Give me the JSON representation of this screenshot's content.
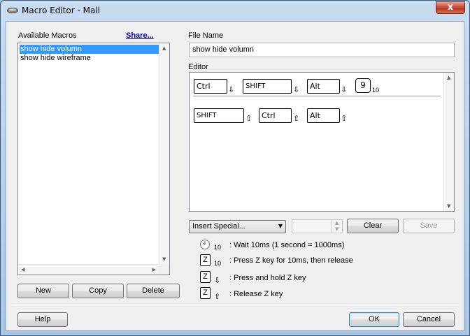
{
  "window": {
    "title": "Macro Editor - Mail",
    "close_label": "x"
  },
  "left": {
    "available_label": "Available Macros",
    "share_label": "Share...",
    "macros": [
      "show hide volumn",
      "show hide wireframe"
    ],
    "new_label": "New",
    "copy_label": "Copy",
    "delete_label": "Delete"
  },
  "right": {
    "file_name_label": "File Name",
    "file_name_value": "show hide volumn",
    "editor_label": "Editor",
    "row1": [
      {
        "key": "Ctrl",
        "icon": "⇩"
      },
      {
        "key": "SHIFT",
        "icon": "⇩"
      },
      {
        "key": "Alt",
        "icon": "⇩"
      },
      {
        "key": "9",
        "sub": "10"
      }
    ],
    "row2": [
      {
        "key": "SHIFT",
        "icon": "⇧"
      },
      {
        "key": "Ctrl",
        "icon": "⇧"
      },
      {
        "key": "Alt",
        "icon": "⇧"
      }
    ],
    "insert_special_label": "Insert Special...",
    "clear_label": "Clear",
    "save_label": "Save"
  },
  "legend": [
    {
      "symbol": "clock",
      "sub": "10",
      "text": ": Wait 10ms (1 second = 1000ms)"
    },
    {
      "symbol": "Z",
      "sub": "10",
      "text": ": Press Z key for 10ms, then release"
    },
    {
      "symbol": "Z",
      "arrow": "⇩",
      "text": ": Press and hold Z key"
    },
    {
      "symbol": "Z",
      "arrow": "⇧",
      "text": ": Release Z key"
    }
  ],
  "footer": {
    "help_label": "Help",
    "ok_label": "OK",
    "cancel_label": "Cancel"
  }
}
